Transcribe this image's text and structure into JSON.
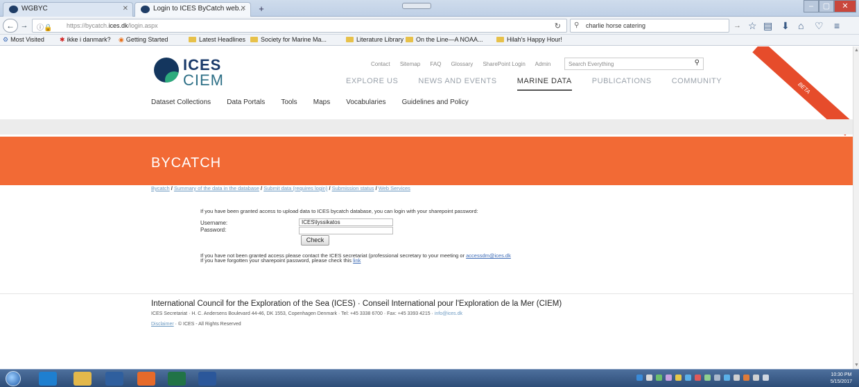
{
  "browser": {
    "tabs": [
      {
        "title": "WGBYC"
      },
      {
        "title": "Login to ICES ByCatch web..."
      }
    ],
    "new_tab": "+",
    "url_prefix": "https://bycatch.",
    "url_domain": "ices.dk",
    "url_path": "/login.aspx",
    "search_query": "charlie horse catering",
    "bookmarks": [
      {
        "label": "Most Visited"
      },
      {
        "label": "ikke i danmark?"
      },
      {
        "label": "Getting Started"
      },
      {
        "label": "Latest Headlines"
      },
      {
        "label": "Society for Marine Ma..."
      },
      {
        "label": "Literature Library"
      },
      {
        "label": "On the Line—A NOAA..."
      },
      {
        "label": "Hilah's Happy Hour!"
      }
    ]
  },
  "site": {
    "logo_top": "ICES",
    "logo_bottom": "CIEM",
    "util_links": [
      "Contact",
      "Sitemap",
      "FAQ",
      "Glossary",
      "SharePoint Login",
      "Admin"
    ],
    "search_placeholder": "Search Everything",
    "main_nav": [
      "EXPLORE US",
      "NEWS AND EVENTS",
      "MARINE DATA",
      "PUBLICATIONS",
      "COMMUNITY"
    ],
    "beta_label": "BETA",
    "sub_nav": [
      "Dataset Collections",
      "Data Portals",
      "Tools",
      "Maps",
      "Vocabularies",
      "Guidelines and Policy"
    ],
    "banner_title": "BYCATCH",
    "breadcrumbs": [
      "Bycatch",
      "Summary of the data in the database",
      "Submit data (requires login)",
      "Submission status",
      "Web Services"
    ],
    "breadcrumb_sep": " / "
  },
  "login": {
    "intro": "If you have been granted access to upload data to ICES bycatch database, you can login with your sharepoint password:",
    "username_label": "Username:",
    "password_label": "Password:",
    "username_value": "ICES\\lyssikatos",
    "check_button": "Check",
    "note1_text": "If you have not been granted access please contact the ICES secretariat (professional secretary to your meeting or ",
    "note1_link": "accessdm@ices.dk",
    "note2_text": "If you have forgotten your sharepoint password, please check this ",
    "note2_link": "link"
  },
  "footer": {
    "title": "International Council for the Exploration of the Sea (ICES) · Conseil International pour l'Exploration de la Mer (CIEM)",
    "address": "ICES Secretariat · H. C. Andersens Boulevard 44-46, DK 1553, Copenhagen Denmark · Tel: +45 3338 6700 · Fax: +45 3393 4215 · ",
    "email": "info@ices.dk",
    "disclaimer": "Disclaimer",
    "copyright": " · © ICES - All Rights Reserved"
  },
  "taskbar": {
    "time": "10:30 PM",
    "date": "5/15/2017"
  },
  "colors": {
    "banner": "#f26a35",
    "beta": "#e64c2b",
    "link": "#6a98c0",
    "logo_navy": "#14365e",
    "logo_green": "#2dab7d"
  }
}
